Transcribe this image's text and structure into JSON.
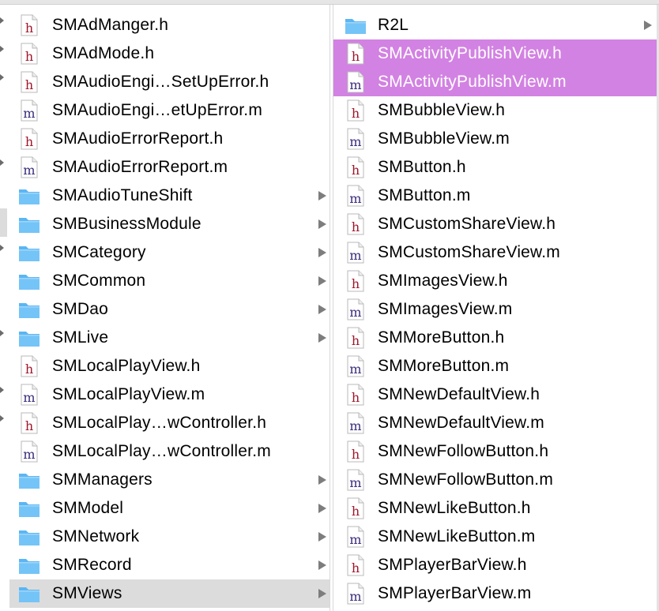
{
  "colors": {
    "selection_purple": "#d282e2",
    "selection_gray": "#dcdcdc",
    "folder_blue": "#5bb6f3",
    "header_h_letter": "#a0162a",
    "source_m_letter": "#3b2a7a"
  },
  "left_column": {
    "items": [
      {
        "name": "SMAdManger.h",
        "kind": "h",
        "icon": "header-file-icon",
        "has_children": false,
        "state": "normal"
      },
      {
        "name": "SMAdMode.h",
        "kind": "h",
        "icon": "header-file-icon",
        "has_children": false,
        "state": "normal"
      },
      {
        "name": "SMAudioEngi…SetUpError.h",
        "kind": "h",
        "icon": "header-file-icon",
        "has_children": false,
        "state": "normal"
      },
      {
        "name": "SMAudioEngi…etUpError.m",
        "kind": "m",
        "icon": "source-file-icon",
        "has_children": false,
        "state": "normal"
      },
      {
        "name": "SMAudioErrorReport.h",
        "kind": "h",
        "icon": "header-file-icon",
        "has_children": false,
        "state": "normal"
      },
      {
        "name": "SMAudioErrorReport.m",
        "kind": "m",
        "icon": "source-file-icon",
        "has_children": false,
        "state": "normal"
      },
      {
        "name": "SMAudioTuneShift",
        "kind": "folder",
        "icon": "folder-icon",
        "has_children": true,
        "state": "normal"
      },
      {
        "name": "SMBusinessModule",
        "kind": "folder",
        "icon": "folder-icon",
        "has_children": true,
        "state": "normal"
      },
      {
        "name": "SMCategory",
        "kind": "folder",
        "icon": "folder-icon",
        "has_children": true,
        "state": "normal"
      },
      {
        "name": "SMCommon",
        "kind": "folder",
        "icon": "folder-icon",
        "has_children": true,
        "state": "normal"
      },
      {
        "name": "SMDao",
        "kind": "folder",
        "icon": "folder-icon",
        "has_children": true,
        "state": "normal"
      },
      {
        "name": "SMLive",
        "kind": "folder",
        "icon": "folder-icon",
        "has_children": true,
        "state": "normal"
      },
      {
        "name": "SMLocalPlayView.h",
        "kind": "h",
        "icon": "header-file-icon",
        "has_children": false,
        "state": "normal"
      },
      {
        "name": "SMLocalPlayView.m",
        "kind": "m",
        "icon": "source-file-icon",
        "has_children": false,
        "state": "normal"
      },
      {
        "name": "SMLocalPlay…wController.h",
        "kind": "h",
        "icon": "header-file-icon",
        "has_children": false,
        "state": "normal"
      },
      {
        "name": "SMLocalPlay…wController.m",
        "kind": "m",
        "icon": "source-file-icon",
        "has_children": false,
        "state": "normal"
      },
      {
        "name": "SMManagers",
        "kind": "folder",
        "icon": "folder-icon",
        "has_children": true,
        "state": "normal"
      },
      {
        "name": "SMModel",
        "kind": "folder",
        "icon": "folder-icon",
        "has_children": true,
        "state": "normal"
      },
      {
        "name": "SMNetwork",
        "kind": "folder",
        "icon": "folder-icon",
        "has_children": true,
        "state": "normal"
      },
      {
        "name": "SMRecord",
        "kind": "folder",
        "icon": "folder-icon",
        "has_children": true,
        "state": "normal"
      },
      {
        "name": "SMViews",
        "kind": "folder",
        "icon": "folder-icon",
        "has_children": true,
        "state": "selected-inactive"
      }
    ]
  },
  "right_column": {
    "items": [
      {
        "name": "R2L",
        "kind": "folder",
        "icon": "folder-icon",
        "has_children": true,
        "state": "normal"
      },
      {
        "name": "SMActivityPublishView.h",
        "kind": "h",
        "icon": "header-file-icon",
        "has_children": false,
        "state": "selected"
      },
      {
        "name": "SMActivityPublishView.m",
        "kind": "m",
        "icon": "source-file-icon",
        "has_children": false,
        "state": "selected"
      },
      {
        "name": "SMBubbleView.h",
        "kind": "h",
        "icon": "header-file-icon",
        "has_children": false,
        "state": "normal"
      },
      {
        "name": "SMBubbleView.m",
        "kind": "m",
        "icon": "source-file-icon",
        "has_children": false,
        "state": "normal"
      },
      {
        "name": "SMButton.h",
        "kind": "h",
        "icon": "header-file-icon",
        "has_children": false,
        "state": "normal"
      },
      {
        "name": "SMButton.m",
        "kind": "m",
        "icon": "source-file-icon",
        "has_children": false,
        "state": "normal"
      },
      {
        "name": "SMCustomShareView.h",
        "kind": "h",
        "icon": "header-file-icon",
        "has_children": false,
        "state": "normal"
      },
      {
        "name": "SMCustomShareView.m",
        "kind": "m",
        "icon": "source-file-icon",
        "has_children": false,
        "state": "normal"
      },
      {
        "name": "SMImagesView.h",
        "kind": "h",
        "icon": "header-file-icon",
        "has_children": false,
        "state": "normal"
      },
      {
        "name": "SMImagesView.m",
        "kind": "m",
        "icon": "source-file-icon",
        "has_children": false,
        "state": "normal"
      },
      {
        "name": "SMMoreButton.h",
        "kind": "h",
        "icon": "header-file-icon",
        "has_children": false,
        "state": "normal"
      },
      {
        "name": "SMMoreButton.m",
        "kind": "m",
        "icon": "source-file-icon",
        "has_children": false,
        "state": "normal"
      },
      {
        "name": "SMNewDefaultView.h",
        "kind": "h",
        "icon": "header-file-icon",
        "has_children": false,
        "state": "normal"
      },
      {
        "name": "SMNewDefaultView.m",
        "kind": "m",
        "icon": "source-file-icon",
        "has_children": false,
        "state": "normal"
      },
      {
        "name": "SMNewFollowButton.h",
        "kind": "h",
        "icon": "header-file-icon",
        "has_children": false,
        "state": "normal"
      },
      {
        "name": "SMNewFollowButton.m",
        "kind": "m",
        "icon": "source-file-icon",
        "has_children": false,
        "state": "normal"
      },
      {
        "name": "SMNewLikeButton.h",
        "kind": "h",
        "icon": "header-file-icon",
        "has_children": false,
        "state": "normal"
      },
      {
        "name": "SMNewLikeButton.m",
        "kind": "m",
        "icon": "source-file-icon",
        "has_children": false,
        "state": "normal"
      },
      {
        "name": "SMPlayerBarView.h",
        "kind": "h",
        "icon": "header-file-icon",
        "has_children": false,
        "state": "normal"
      },
      {
        "name": "SMPlayerBarView.m",
        "kind": "m",
        "icon": "source-file-icon",
        "has_children": false,
        "state": "normal"
      }
    ]
  }
}
